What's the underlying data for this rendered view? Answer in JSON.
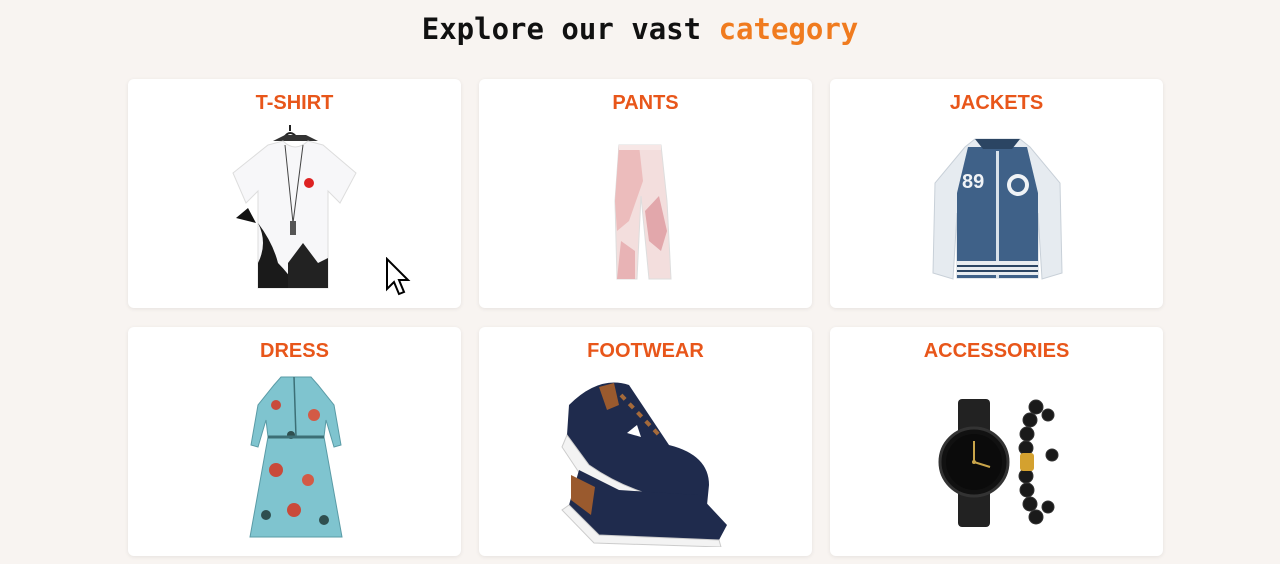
{
  "heading": {
    "prefix": "Explore our vast",
    "accent": "category"
  },
  "categories": [
    {
      "label": "T-SHIRT",
      "icon": "tshirt-image"
    },
    {
      "label": "PANTS",
      "icon": "pants-image"
    },
    {
      "label": "JACKETS",
      "icon": "jacket-image"
    },
    {
      "label": "DRESS",
      "icon": "dress-image"
    },
    {
      "label": "FOOTWEAR",
      "icon": "sneakers-image"
    },
    {
      "label": "ACCESSORIES",
      "icon": "watch-bracelet-image"
    }
  ],
  "colors": {
    "accent": "#f07b1f",
    "title": "#e8561a",
    "background": "#f8f4f1"
  }
}
